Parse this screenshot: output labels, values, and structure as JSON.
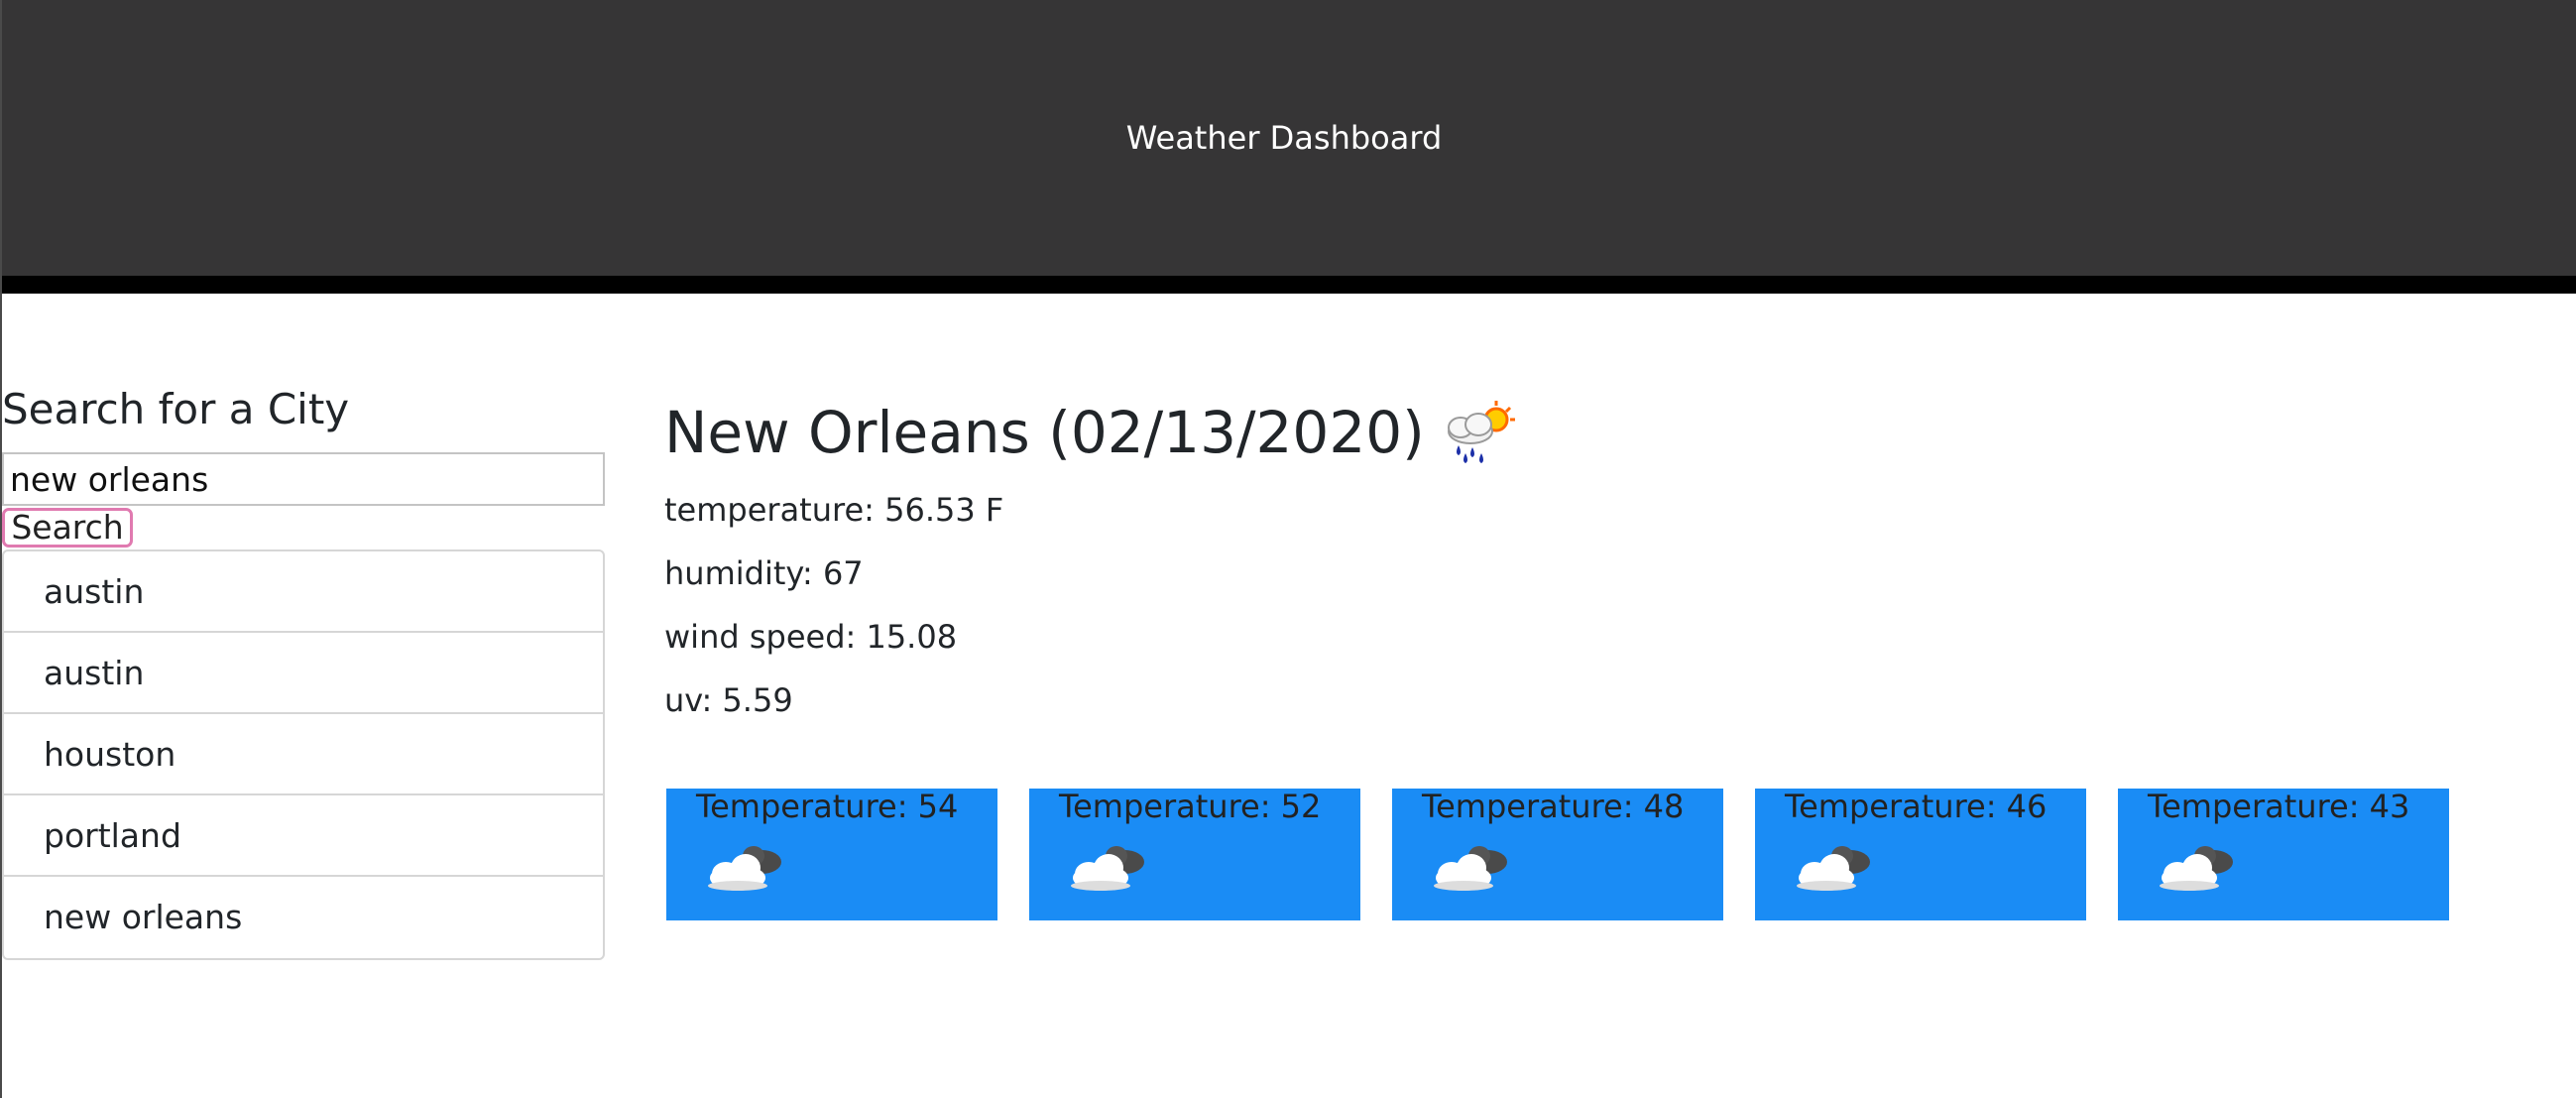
{
  "header": {
    "title": "Weather Dashboard"
  },
  "sidebar": {
    "heading": "Search for a City",
    "search_value": "new orleans",
    "search_button": "Search",
    "cities": [
      "austin",
      "austin",
      "houston",
      "portland",
      "new orleans"
    ]
  },
  "current": {
    "title": "New Orleans (02/13/2020)",
    "icon": "rain-sun-cloud-icon",
    "temperature": "temperature: 56.53 F",
    "humidity": "humidity: 67",
    "wind_speed": "wind speed: 15.08",
    "uv": "uv: 5.59"
  },
  "forecast": [
    {
      "temp_label": "Temperature: 54",
      "icon": "partly-cloudy-icon"
    },
    {
      "temp_label": "Temperature: 52",
      "icon": "partly-cloudy-icon"
    },
    {
      "temp_label": "Temperature: 48",
      "icon": "partly-cloudy-icon"
    },
    {
      "temp_label": "Temperature: 46",
      "icon": "partly-cloudy-icon"
    },
    {
      "temp_label": "Temperature: 43",
      "icon": "partly-cloudy-icon"
    }
  ],
  "colors": {
    "header_bg": "#363536",
    "card_bg": "#1a8cf5",
    "button_border": "#e07ab0"
  }
}
